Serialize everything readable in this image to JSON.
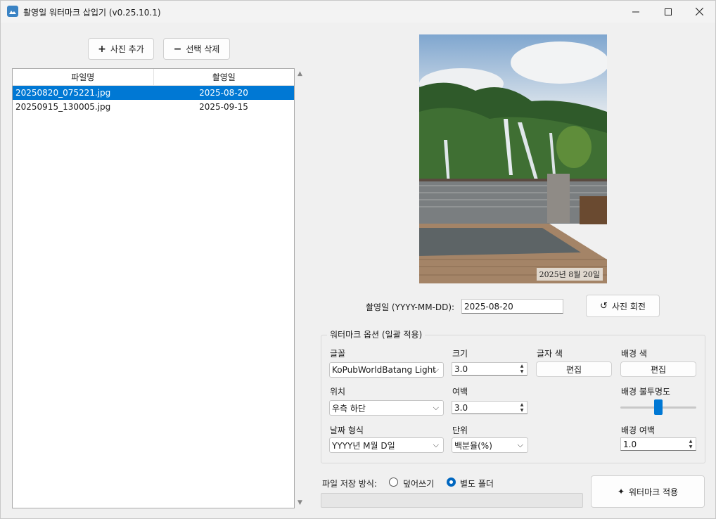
{
  "window": {
    "title": "촬영일 워터마크 삽입기 (v0.25.10.1)"
  },
  "toolbar": {
    "add_label": "사진 추가",
    "delete_label": "선택 삭제"
  },
  "file_list": {
    "columns": [
      "파일명",
      "촬영일"
    ],
    "rows": [
      {
        "name": "20250820_075221.jpg",
        "date": "2025-08-20",
        "selected": true
      },
      {
        "name": "20250915_130005.jpg",
        "date": "2025-09-15",
        "selected": false
      }
    ]
  },
  "preview": {
    "watermark_text": "2025년 8월 20일"
  },
  "date_edit": {
    "label": "촬영일 (YYYY-MM-DD):",
    "value": "2025-08-20",
    "rotate_label": "사진 회전"
  },
  "options": {
    "title": "워터마크 옵션 (일괄 적용)",
    "font_label": "글꼴",
    "font_value": "KoPubWorldBatang Light",
    "size_label": "크기",
    "size_value": "3.0",
    "text_color_label": "글자 색",
    "text_color_button": "편집",
    "bg_color_label": "배경 색",
    "bg_color_button": "편집",
    "position_label": "위치",
    "position_value": "우측 하단",
    "margin_label": "여백",
    "margin_value": "3.0",
    "opacity_label": "배경 불투명도",
    "opacity_value": 0.5,
    "date_format_label": "날짜 형식",
    "date_format_value": "YYYY년 M월 D일",
    "unit_label": "단위",
    "unit_value": "백분율(%)",
    "bg_margin_label": "배경 여백",
    "bg_margin_value": "1.0"
  },
  "save": {
    "label": "파일 저장 방식:",
    "overwrite_label": "덮어쓰기",
    "folder_label": "별도 폴더",
    "selected": "folder"
  },
  "apply": {
    "label": "워터마크 적용"
  },
  "progress": {
    "value": 0
  },
  "colors": {
    "accent": "#0078d4",
    "selection": "#0078d4"
  }
}
